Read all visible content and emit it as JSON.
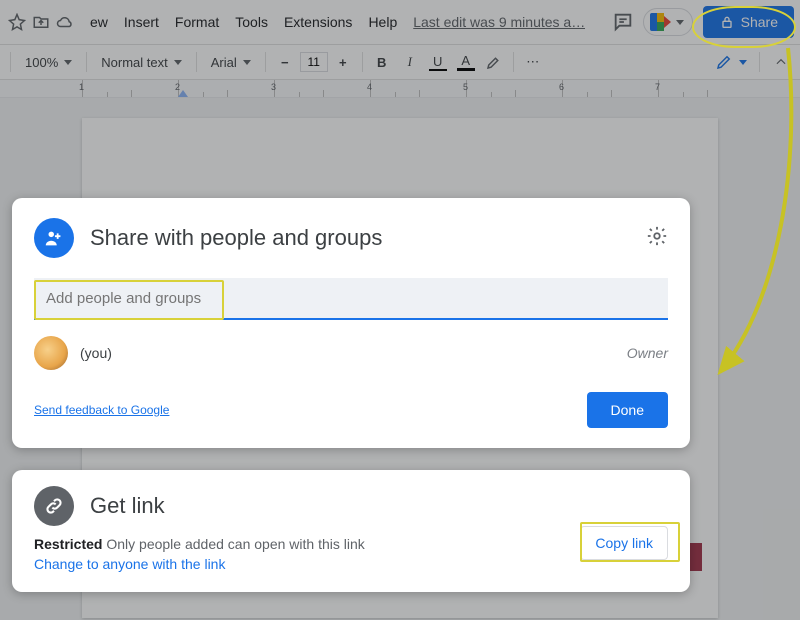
{
  "menu": {
    "items": [
      "ew",
      "Insert",
      "Format",
      "Tools",
      "Extensions",
      "Help"
    ],
    "last_edit": "Last edit was 9 minutes a…"
  },
  "share_button": {
    "label": "Share"
  },
  "toolbar": {
    "zoom": "100%",
    "style": "Normal text",
    "font": "Arial",
    "size": "11",
    "bold": "B",
    "italic": "I",
    "underline": "U",
    "color": "A"
  },
  "ruler": {
    "marks": [
      "1",
      "2",
      "3",
      "4",
      "5",
      "6",
      "7"
    ]
  },
  "share_modal": {
    "title": "Share with people and groups",
    "add_placeholder": "Add people and groups",
    "you_suffix": "(you)",
    "role": "Owner",
    "feedback": "Send feedback to Google",
    "done": "Done"
  },
  "link_modal": {
    "title": "Get link",
    "restricted_label": "Restricted",
    "restricted_text": "Only people added can open with this link",
    "change": "Change to anyone with the link",
    "copy": "Copy link"
  }
}
